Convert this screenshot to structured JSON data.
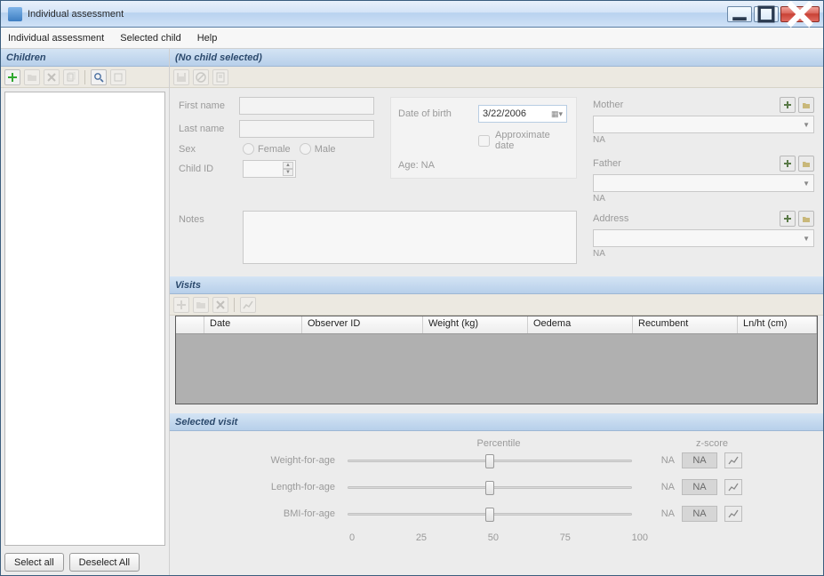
{
  "window": {
    "title": "Individual assessment"
  },
  "menu": {
    "items": [
      "Individual assessment",
      "Selected child",
      "Help"
    ]
  },
  "left": {
    "header": "Children",
    "select_all": "Select all",
    "deselect_all": "Deselect All"
  },
  "child_panel": {
    "header": "(No child selected)",
    "labels": {
      "first_name": "First name",
      "last_name": "Last name",
      "sex": "Sex",
      "female": "Female",
      "male": "Male",
      "child_id": "Child ID",
      "notes": "Notes",
      "dob": "Date of birth",
      "approx": "Approximate date",
      "age": "Age: NA",
      "mother": "Mother",
      "father": "Father",
      "address": "Address",
      "na": "NA"
    },
    "dob_value": "3/22/2006"
  },
  "visits": {
    "header": "Visits",
    "columns": [
      "",
      "Date",
      "Observer ID",
      "Weight (kg)",
      "Oedema",
      "Recumbent",
      "Ln/ht (cm)"
    ]
  },
  "selected_visit": {
    "header": "Selected visit",
    "percentile_label": "Percentile",
    "zscore_label": "z-score",
    "metrics": [
      {
        "label": "Weight-for-age",
        "na": "NA",
        "z": "NA"
      },
      {
        "label": "Length-for-age",
        "na": "NA",
        "z": "NA"
      },
      {
        "label": "BMI-for-age",
        "na": "NA",
        "z": "NA"
      }
    ],
    "ticks": [
      "0",
      "25",
      "50",
      "75",
      "100"
    ]
  }
}
